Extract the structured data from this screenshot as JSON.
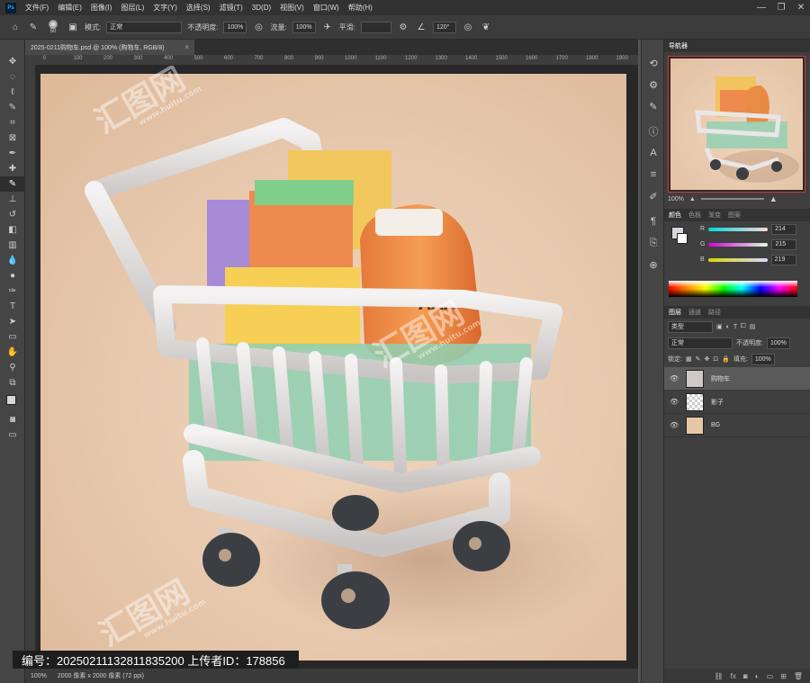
{
  "menu": {
    "logo": "Ps",
    "items": [
      "文件(F)",
      "编辑(E)",
      "图像(I)",
      "图层(L)",
      "文字(Y)",
      "选择(S)",
      "滤镜(T)",
      "3D(D)",
      "视图(V)",
      "窗口(W)",
      "帮助(H)"
    ],
    "minimize": "—",
    "restore": "❐",
    "close": "✕"
  },
  "options": {
    "brush_size": "50",
    "mode_label": "模式:",
    "mode_value": "正常",
    "opacity_label": "不透明度:",
    "opacity_value": "100%",
    "flow_label": "流量:",
    "flow_value": "100%",
    "smooth_label": "平滑:",
    "angle_value": "120°"
  },
  "document": {
    "tab_title": "2025-0211购物车.psd @ 100% (购物车, RGB/8)",
    "tab_close": "×"
  },
  "ruler": {
    "ticks": [
      "0",
      "100",
      "200",
      "300",
      "400",
      "500",
      "600",
      "700",
      "800",
      "900",
      "1000",
      "1100",
      "1200",
      "1300",
      "1400",
      "1500",
      "1600",
      "1700",
      "1800",
      "1900"
    ]
  },
  "status": {
    "zoom": "100%",
    "size": "2000 像素 x 2000 像素 (72 ppi)"
  },
  "watermark": {
    "id_text": "编号：20250211132811835200   上传者ID：178856",
    "brand": "汇图网",
    "url": "www.huitu.com"
  },
  "navigator": {
    "tab": "导航器",
    "zoom": "100%"
  },
  "color_panel": {
    "tabs": [
      "颜色",
      "色板",
      "渐变",
      "图案"
    ],
    "r_label": "R",
    "g_label": "G",
    "b_label": "B",
    "r_value": "214",
    "g_value": "215",
    "b_value": "219"
  },
  "layers_panel": {
    "tabs": [
      "图层",
      "通道",
      "路径"
    ],
    "filter": "类型",
    "blend_mode": "正常",
    "opacity_label": "不透明度:",
    "opacity_value": "100%",
    "lock_label": "锁定:",
    "fill_label": "填充:",
    "fill_value": "100%",
    "layers": [
      {
        "name": "购物车",
        "selected": true
      },
      {
        "name": "影子",
        "selected": false
      },
      {
        "name": "BG",
        "selected": false
      }
    ]
  },
  "colors": {
    "canvas_bg": "#e9cdb3",
    "accent_red": "#d33333"
  }
}
